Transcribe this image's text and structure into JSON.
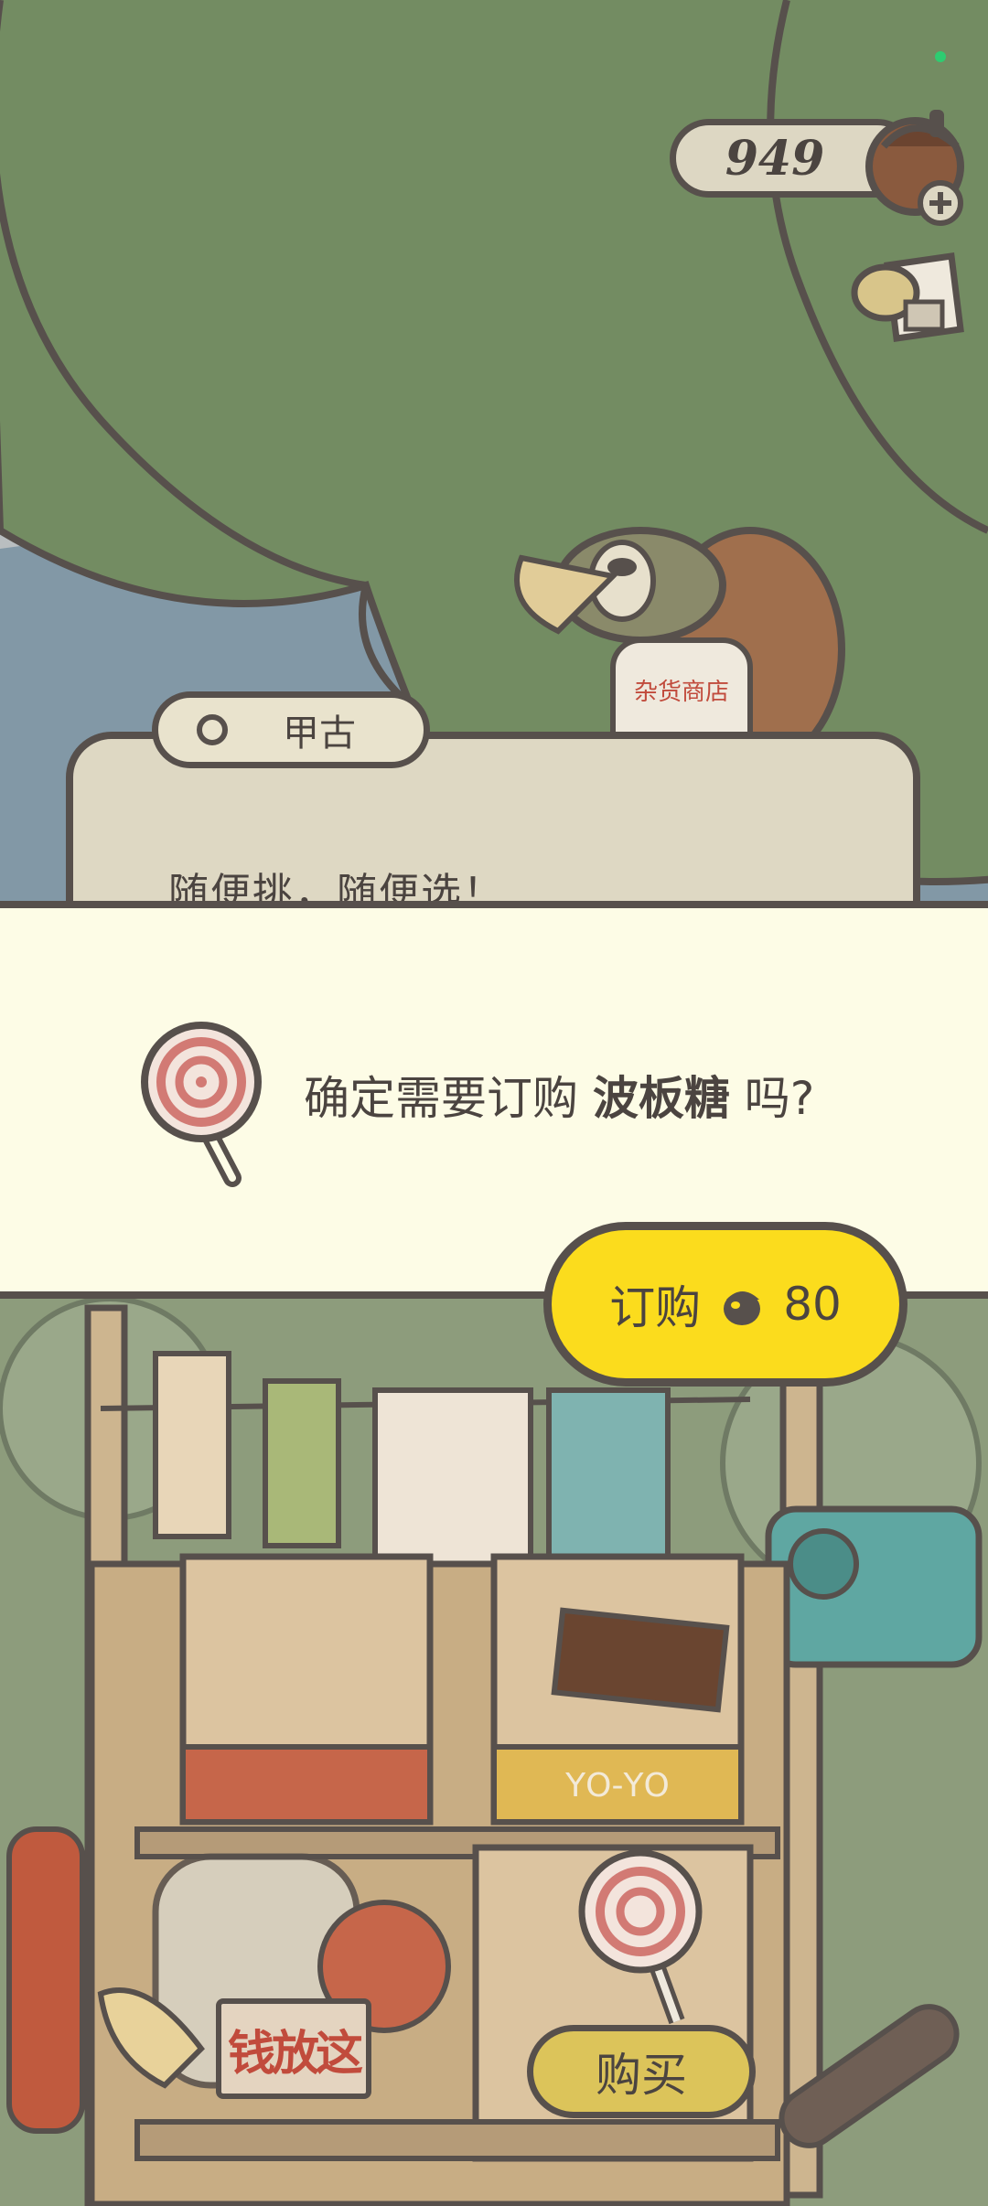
{
  "hud": {
    "coins": "949"
  },
  "npc": {
    "name": "甲古",
    "speech": "随便挑，随便选！",
    "apron_text": "杂货商店"
  },
  "dialog": {
    "prefix": "确定需要订购 ",
    "item": "波板糖",
    "suffix": " 吗?",
    "order_label": "订购",
    "order_price": "80"
  },
  "shop": {
    "sign_text": "钱放这",
    "buy_label": "购买",
    "box_label": "ΥΟ-ΥΟ"
  },
  "colors": {
    "outline": "#57504c",
    "dialog_bg": "#fdfce6",
    "order_btn": "#fbdc1d",
    "buy_btn": "#dcc45a",
    "tree": "#738c62"
  }
}
